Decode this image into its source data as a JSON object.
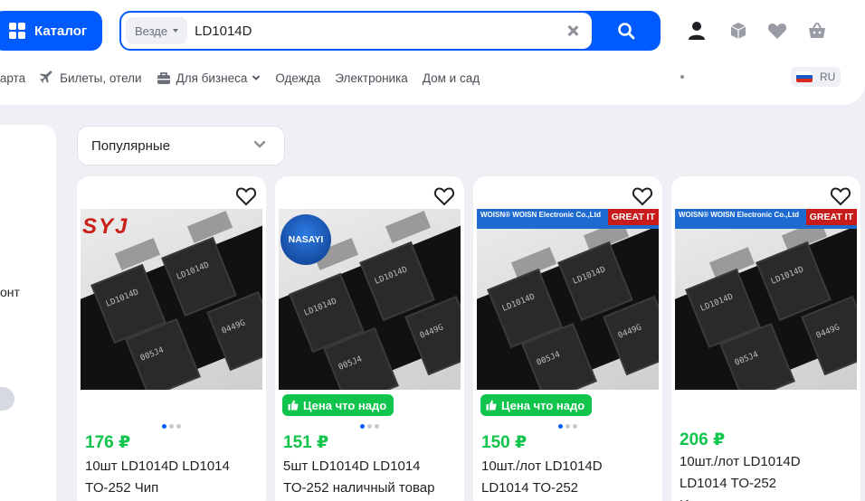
{
  "header": {
    "catalog_label": "Каталог",
    "search": {
      "scope": "Везде",
      "value": "LD1014D"
    },
    "icons": [
      "user-icon",
      "orders-icon",
      "heart-icon",
      "cart-icon"
    ]
  },
  "nav": {
    "items": [
      {
        "label": "Карта"
      },
      {
        "label": "Билеты, отели",
        "icon": "plane-icon"
      },
      {
        "label": "Для бизнеса",
        "icon": "briefcase-icon"
      },
      {
        "label": "Одежда"
      },
      {
        "label": "Электроника"
      },
      {
        "label": "Дом и сад"
      }
    ],
    "language": "RU"
  },
  "sidebar": {
    "text_fragment": "онт"
  },
  "sort": {
    "selected": "Популярные"
  },
  "colors": {
    "brand_blue": "#005bff",
    "price_green": "#10c44c",
    "page_bg": "#eef0f5"
  },
  "products": [
    {
      "price": "176 ₽",
      "title_line1": "10шт LD1014D LD1014",
      "title_line2": "TO-252 Чип",
      "badge": "",
      "brand_mark": "SYJ",
      "chip_marking": [
        "LD1014D",
        "005J4",
        "0449G"
      ],
      "images": 3,
      "active_image": 1
    },
    {
      "price": "151 ₽",
      "title_line1": "5шт LD1014D LD1014",
      "title_line2": "TO-252 наличный товар",
      "badge": "Цена что надо",
      "brand_mark": "NASAYI",
      "chip_marking": [
        "LD1014D",
        "005J4",
        "0449G"
      ],
      "images": 3,
      "active_image": 1
    },
    {
      "price": "150 ₽",
      "title_line1": "10шт./лот LD1014D",
      "title_line2": "LD1014 TO-252",
      "badge": "Цена что надо",
      "brand_mark": "WOISN",
      "brand_bar": "WOISN®  WOISN Electronic Co.,Ltd",
      "corner_tag": "GREAT IT",
      "chip_marking": [
        "LD1014D",
        "005J4",
        "0449G"
      ],
      "images": 3,
      "active_image": 1
    },
    {
      "price": "206 ₽",
      "title_line1": "10шт./лот LD1014D",
      "title_line2": "LD1014 TO-252",
      "title_line3": "И",
      "badge": "",
      "brand_mark": "WOISN",
      "brand_bar": "WOISN®  WOISN Electronic Co.,Ltd",
      "corner_tag": "GREAT IT",
      "chip_marking": [
        "LD1014D",
        "005J4",
        "0449G"
      ],
      "images": 0,
      "active_image": 0
    }
  ]
}
